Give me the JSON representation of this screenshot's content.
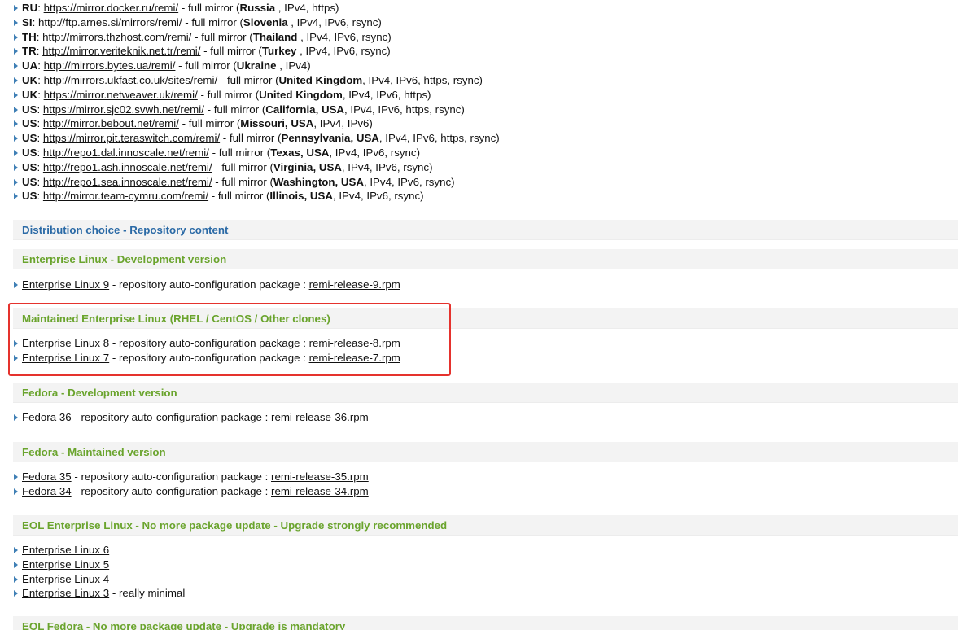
{
  "mirrors": [
    {
      "cc": "RU",
      "url": "https://mirror.docker.ru/remi/",
      "linked": true,
      "desc": " - full mirror (",
      "location": "Russia",
      "extra": " , IPv4, https)"
    },
    {
      "cc": "SI",
      "url": "http://ftp.arnes.si/mirrors/remi/",
      "linked": false,
      "desc": " - full mirror (",
      "location": "Slovenia",
      "extra": " , IPv4, IPv6, rsync)"
    },
    {
      "cc": "TH",
      "url": "http://mirrors.thzhost.com/remi/",
      "linked": true,
      "desc": " - full mirror (",
      "location": "Thailand",
      "extra": " , IPv4, IPv6, rsync)"
    },
    {
      "cc": "TR",
      "url": "http://mirror.veriteknik.net.tr/remi/",
      "linked": true,
      "desc": " - full mirror (",
      "location": "Turkey",
      "extra": " , IPv4, IPv6, rsync)"
    },
    {
      "cc": "UA",
      "url": "http://mirrors.bytes.ua/remi/",
      "linked": true,
      "desc": " - full mirror (",
      "location": "Ukraine",
      "extra": " , IPv4)"
    },
    {
      "cc": "UK",
      "url": "http://mirrors.ukfast.co.uk/sites/remi/",
      "linked": true,
      "desc": " - full mirror (",
      "location": "United Kingdom",
      "extra": ", IPv4, IPv6, https, rsync)"
    },
    {
      "cc": "UK",
      "url": "https://mirror.netweaver.uk/remi/",
      "linked": true,
      "desc": " - full mirror (",
      "location": "United Kingdom",
      "extra": ", IPv4, IPv6, https)"
    },
    {
      "cc": "US",
      "url": "https://mirror.sjc02.svwh.net/remi/",
      "linked": true,
      "desc": " - full mirror (",
      "location": "California, USA",
      "extra": ", IPv4, IPv6, https, rsync)"
    },
    {
      "cc": "US",
      "url": "http://mirror.bebout.net/remi/",
      "linked": true,
      "desc": " - full mirror (",
      "location": "Missouri, USA",
      "extra": ", IPv4, IPv6)"
    },
    {
      "cc": "US",
      "url": "https://mirror.pit.teraswitch.com/remi/",
      "linked": true,
      "desc": " - full mirror (",
      "location": "Pennsylvania, USA",
      "extra": ", IPv4, IPv6, https, rsync)"
    },
    {
      "cc": "US",
      "url": "http://repo1.dal.innoscale.net/remi/",
      "linked": true,
      "desc": " - full mirror (",
      "location": "Texas, USA",
      "extra": ", IPv4, IPv6, rsync)"
    },
    {
      "cc": "US",
      "url": "http://repo1.ash.innoscale.net/remi/",
      "linked": true,
      "desc": " - full mirror (",
      "location": "Virginia, USA",
      "extra": ", IPv4, IPv6, rsync)"
    },
    {
      "cc": "US",
      "url": "http://repo1.sea.innoscale.net/remi/",
      "linked": true,
      "desc": " - full mirror (",
      "location": "Washington, USA",
      "extra": ", IPv4, IPv6, rsync)"
    },
    {
      "cc": "US",
      "url": "http://mirror.team-cymru.com/remi/",
      "linked": true,
      "desc": " - full mirror (",
      "location": "Illinois, USA",
      "extra": ", IPv4, IPv6, rsync)"
    }
  ],
  "sections": {
    "dist_choice": {
      "part1": "Distribution choice",
      "sep": " - ",
      "part2": "Repository content"
    },
    "el_dev": {
      "title": "Enterprise Linux - Development version"
    },
    "el_maint": {
      "title": "Maintained Enterprise Linux (RHEL / CentOS / Other clones)"
    },
    "fed_dev": {
      "title": "Fedora - Development version"
    },
    "fed_maint": {
      "title": "Fedora - Maintained version"
    },
    "eol_el": {
      "title": "EOL Enterprise Linux - No more package update - Upgrade strongly recommended"
    },
    "eol_fed": {
      "title": "EOL Fedora - No more package update - Upgrade is mandatory"
    }
  },
  "pkg_desc": " - repository auto-configuration package : ",
  "el_dev_items": [
    {
      "name": "Enterprise Linux 9",
      "rpm": "remi-release-9.rpm"
    }
  ],
  "el_maint_items": [
    {
      "name": "Enterprise Linux 8",
      "rpm": "remi-release-8.rpm"
    },
    {
      "name": "Enterprise Linux 7",
      "rpm": "remi-release-7.rpm"
    }
  ],
  "fed_dev_items": [
    {
      "name": "Fedora 36",
      "rpm": "remi-release-36.rpm"
    }
  ],
  "fed_maint_items": [
    {
      "name": "Fedora 35",
      "rpm": "remi-release-35.rpm"
    },
    {
      "name": "Fedora 34",
      "rpm": "remi-release-34.rpm"
    }
  ],
  "eol_el_items": [
    {
      "name": "Enterprise Linux 6",
      "suffix": ""
    },
    {
      "name": "Enterprise Linux 5",
      "suffix": ""
    },
    {
      "name": "Enterprise Linux 4",
      "suffix": ""
    },
    {
      "name": "Enterprise Linux 3",
      "suffix": " - really minimal"
    }
  ],
  "colors": {
    "link_blue_section": "#2b6aa6",
    "section_green": "#6aa42d",
    "bullet": "#3f7fb5",
    "highlight_box": "#e5322d",
    "section_bg": "#f3f3f3"
  },
  "icons": {
    "bullet": "triangle-right-icon"
  }
}
